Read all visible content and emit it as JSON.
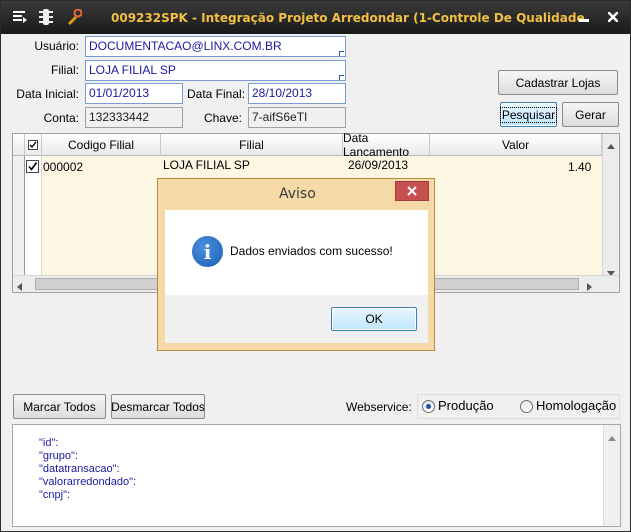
{
  "window": {
    "title": "009232SPK - Integração Projeto Arredondar (1-Controle De Qualidade",
    "icons": [
      "menu-icon",
      "traffic-light-icon",
      "wrench-icon"
    ]
  },
  "form": {
    "usuario_label": "Usuário:",
    "usuario_value": "DOCUMENTACAO@LINX.COM.BR",
    "filial_label": "Filial:",
    "filial_value": "LOJA FILIAL SP",
    "data_inicial_label": "Data Inicial:",
    "data_inicial_value": "01/01/2013",
    "data_final_label": "Data Final:",
    "data_final_value": "28/10/2013",
    "conta_label": "Conta:",
    "conta_value": "132333442",
    "chave_label": "Chave:",
    "chave_value": "7-aifS6eTI"
  },
  "buttons": {
    "cadastrar_lojas": "Cadastrar Lojas",
    "pesquisar": "Pesquisar",
    "gerar": "Gerar",
    "marcar_todos": "Marcar Todos",
    "desmarcar_todos": "Desmarcar Todos"
  },
  "grid": {
    "columns": [
      "Codigo Filial",
      "Filial",
      "Data Lancamento",
      "Valor"
    ],
    "rows": [
      {
        "checked": true,
        "codigo": "000002",
        "filial": "LOJA FILIAL SP",
        "data": "26/09/2013",
        "valor": "1.40"
      }
    ]
  },
  "dialog": {
    "title": "Aviso",
    "message": "Dados enviados com sucesso!",
    "ok_label": "OK",
    "icon": "info-icon"
  },
  "webservice": {
    "label": "Webservice:",
    "options": [
      {
        "label": "Produção",
        "selected": true
      },
      {
        "label": "Homologação",
        "selected": false
      }
    ]
  },
  "json_preview": [
    "\"id\":",
    "\"grupo\":",
    "\"datatransacao\":",
    "\"valorarredondado\":",
    "\"cnpj\":"
  ]
}
